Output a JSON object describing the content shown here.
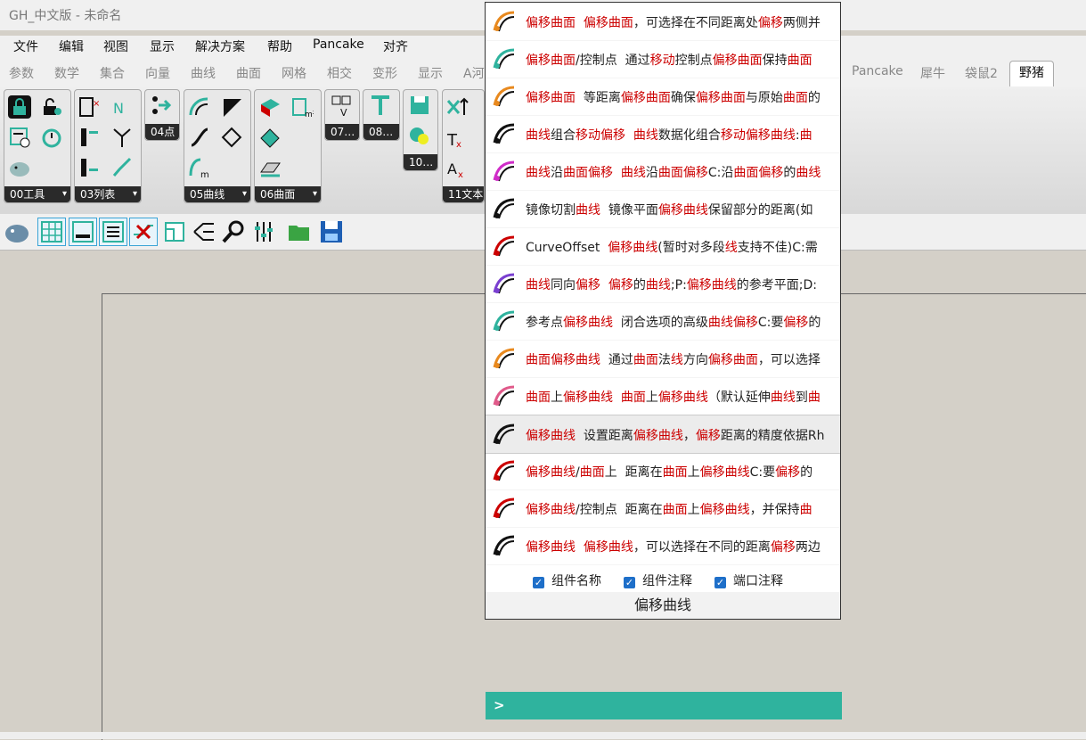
{
  "window": {
    "title": "GH_中文版 - 未命名"
  },
  "menu": [
    "文件",
    "编辑",
    "视图",
    "显示",
    "解决方案",
    "帮助",
    "Pancake",
    "对齐"
  ],
  "tabs": {
    "left": [
      "参数",
      "数学",
      "集合",
      "向量",
      "曲线",
      "曲面",
      "网格",
      "相交",
      "变形",
      "显示",
      "A河"
    ],
    "right": [
      "Pancake",
      "犀牛",
      "袋鼠2",
      "野猪"
    ],
    "active": "野猪"
  },
  "ribbon": {
    "groups": [
      {
        "label": "00工具",
        "dropdown": true
      },
      {
        "label": "03列表",
        "dropdown": true
      },
      {
        "label": "04点",
        "dropdown": false
      },
      {
        "label": "05曲线",
        "dropdown": true
      },
      {
        "label": "06曲面",
        "dropdown": true
      },
      {
        "label": "07…",
        "dropdown": false
      },
      {
        "label": "08…",
        "dropdown": false
      },
      {
        "label": "10…",
        "dropdown": false
      },
      {
        "label": "11文本",
        "dropdown": false
      }
    ],
    "dropdown_glyph": "▾"
  },
  "toolbar_icons": [
    "rhino-icon",
    "grid-icon",
    "panel-bottom-icon",
    "panel-lines-icon",
    "disable-icon",
    "canvas-icon",
    "graph-icon",
    "zoom-icon",
    "sliders-icon",
    "open-folder-icon",
    "save-icon"
  ],
  "popup": {
    "rows": [
      {
        "icon": "offset-surface-icon",
        "name": "偏移曲面",
        "desc": "偏移曲面，可选择在不同距离处偏移两侧并",
        "highlighted": false
      },
      {
        "icon": "offset-surface-cp-icon",
        "name": "偏移曲面/控制点",
        "desc": "通过移动控制点偏移曲面保持曲面",
        "highlighted": false
      },
      {
        "icon": "offset-surface-equal-icon",
        "name": "偏移曲面",
        "desc": "等距离偏移曲面确保偏移曲面与原始曲面的",
        "highlighted": false
      },
      {
        "icon": "curve-combo-move-icon",
        "name": "曲线组合移动偏移",
        "desc": "曲线数据化组合移动偏移曲线:曲",
        "highlighted": false
      },
      {
        "icon": "curve-on-surface-icon",
        "name": "曲线沿曲面偏移",
        "desc": "曲线沿曲面偏移C:沿曲面偏移的曲线",
        "highlighted": false
      },
      {
        "icon": "mirror-cut-icon",
        "name": "镜像切割曲线",
        "desc": "镜像平面偏移曲线保留部分的距离(如",
        "highlighted": false
      },
      {
        "icon": "curve-offset-icon",
        "name": "CurveOffset",
        "desc": "偏移曲线(暂时对多段线支持不佳)C:需",
        "highlighted": false
      },
      {
        "icon": "curve-same-dir-icon",
        "name": "曲线同向偏移",
        "desc": "偏移的曲线;P:偏移曲线的参考平面;D:",
        "highlighted": false
      },
      {
        "icon": "ref-point-offset-icon",
        "name": "参考点偏移曲线",
        "desc": "闭合选项的高级曲线偏移C:要偏移的",
        "highlighted": false
      },
      {
        "icon": "surface-offset-curve-icon",
        "name": "曲面偏移曲线",
        "desc": "通过曲面法线方向偏移曲面，可以选择",
        "highlighted": false
      },
      {
        "icon": "on-surface-offset-icon",
        "name": "曲面上偏移曲线",
        "desc": "曲面上偏移曲线（默认延伸曲线到曲",
        "highlighted": false
      },
      {
        "icon": "offset-curve-distance-icon",
        "name": "偏移曲线",
        "desc": "设置距离偏移曲线，偏移距离的精度依据Rh",
        "highlighted": true
      },
      {
        "icon": "offset-curve-on-surface-icon",
        "name": "偏移曲线/曲面上",
        "desc": "距离在曲面上偏移曲线C:要偏移的",
        "highlighted": false
      },
      {
        "icon": "offset-curve-cp-icon",
        "name": "偏移曲线/控制点",
        "desc": "距离在曲面上偏移曲线，并保持曲",
        "highlighted": false
      },
      {
        "icon": "offset-curve-both-icon",
        "name": "偏移曲线",
        "desc": "偏移曲线，可以选择在不同的距离偏移两边",
        "highlighted": false
      }
    ],
    "keywords": [
      "偏移",
      "曲面",
      "曲线",
      "移动",
      "线",
      "曲",
      "移"
    ],
    "checkboxes": [
      {
        "label": "组件名称",
        "checked": true
      },
      {
        "label": "组件注释",
        "checked": true
      },
      {
        "label": "端口注释",
        "checked": true
      }
    ],
    "footer": "偏移曲线"
  },
  "search": {
    "prompt": ">",
    "value": ""
  },
  "colors": {
    "accent": "#2fb39e",
    "keyword": "#cc0000",
    "checkbox": "#1e6fc9"
  }
}
